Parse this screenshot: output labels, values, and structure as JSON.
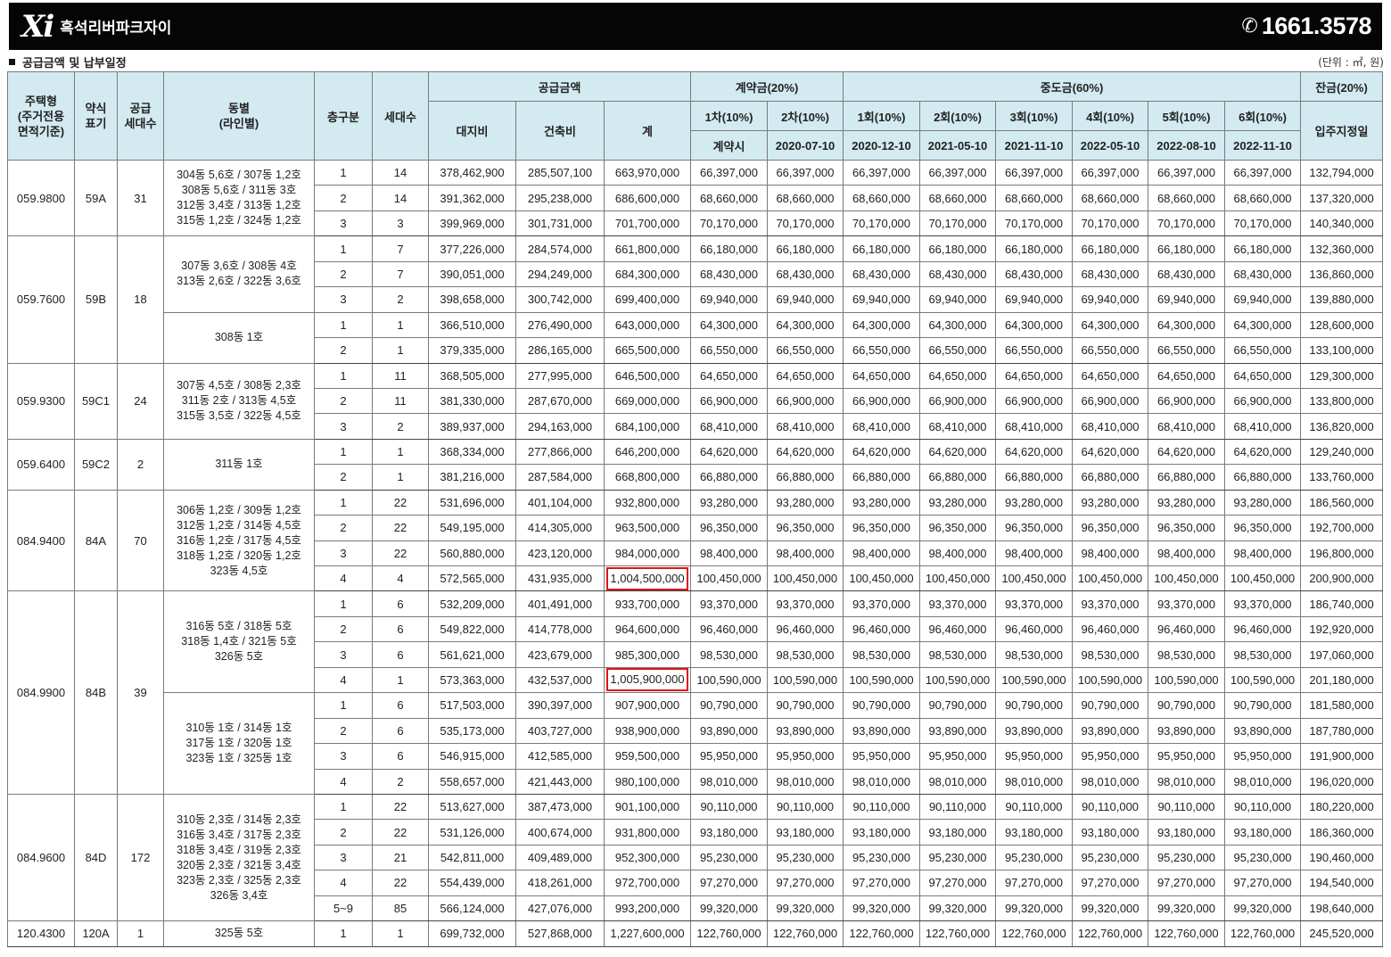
{
  "header": {
    "logo": "Xi",
    "brand_name": "흑석리버파크자이",
    "phone_icon": "phone-icon",
    "phone": "1661.3578",
    "background_color": "#050505"
  },
  "section": {
    "title": "공급금액 및 납부일정",
    "unit": "(단위 : ㎡, 원)"
  },
  "table": {
    "header_color": "#d3eaf0",
    "highlight_color": "#e01515",
    "headers": {
      "housing_type": [
        "주택형",
        "(주거전용",
        "면적기준)"
      ],
      "abbr": [
        "약식",
        "표기"
      ],
      "supply_units": [
        "공급",
        "세대수"
      ],
      "dong": [
        "동별",
        "(라인별)"
      ],
      "floor": "층구분",
      "units": "세대수",
      "supply_price": "공급금액",
      "land": "대지비",
      "building": "건축비",
      "total": "계",
      "contract": "계약금(20%)",
      "contract_1": "1차(10%)",
      "contract_2": "2차(10%)",
      "contract_1_date": "계약시",
      "contract_2_date": "2020-07-10",
      "middle": "중도금(60%)",
      "middle_labels": [
        "1회(10%)",
        "2회(10%)",
        "3회(10%)",
        "4회(10%)",
        "5회(10%)",
        "6회(10%)"
      ],
      "middle_dates": [
        "2020-12-10",
        "2021-05-10",
        "2021-11-10",
        "2022-05-10",
        "2022-08-10",
        "2022-11-10"
      ],
      "balance": "잔금(20%)",
      "balance_date": "입주지정일"
    },
    "types": [
      {
        "area": "059.9800",
        "abbr": "59A",
        "supply": "31",
        "groups": [
          {
            "dong": [
              "304동 5,6호 / 307동 1,2호",
              "308동 5,6호 / 311동 3호",
              "312동 3,4호 / 313동 1,2호",
              "315동 1,2호 / 324동 1,2호"
            ],
            "rows": [
              {
                "floor": "1",
                "units": "14",
                "land": "378,462,900",
                "building": "285,507,100",
                "total": "663,970,000",
                "contract": "66,397,000",
                "balance": "132,794,000"
              },
              {
                "floor": "2",
                "units": "14",
                "land": "391,362,000",
                "building": "295,238,000",
                "total": "686,600,000",
                "contract": "68,660,000",
                "balance": "137,320,000"
              },
              {
                "floor": "3",
                "units": "3",
                "land": "399,969,000",
                "building": "301,731,000",
                "total": "701,700,000",
                "contract": "70,170,000",
                "balance": "140,340,000"
              }
            ]
          }
        ]
      },
      {
        "area": "059.7600",
        "abbr": "59B",
        "supply": "18",
        "groups": [
          {
            "dong": [
              "307동 3,6호 / 308동 4호",
              "313동 2,6호 / 322동 3,6호"
            ],
            "rows": [
              {
                "floor": "1",
                "units": "7",
                "land": "377,226,000",
                "building": "284,574,000",
                "total": "661,800,000",
                "contract": "66,180,000",
                "balance": "132,360,000"
              },
              {
                "floor": "2",
                "units": "7",
                "land": "390,051,000",
                "building": "294,249,000",
                "total": "684,300,000",
                "contract": "68,430,000",
                "balance": "136,860,000"
              },
              {
                "floor": "3",
                "units": "2",
                "land": "398,658,000",
                "building": "300,742,000",
                "total": "699,400,000",
                "contract": "69,940,000",
                "balance": "139,880,000"
              }
            ]
          },
          {
            "dong": [
              "308동 1호"
            ],
            "rows": [
              {
                "floor": "1",
                "units": "1",
                "land": "366,510,000",
                "building": "276,490,000",
                "total": "643,000,000",
                "contract": "64,300,000",
                "balance": "128,600,000"
              },
              {
                "floor": "2",
                "units": "1",
                "land": "379,335,000",
                "building": "286,165,000",
                "total": "665,500,000",
                "contract": "66,550,000",
                "balance": "133,100,000"
              }
            ]
          }
        ]
      },
      {
        "area": "059.9300",
        "abbr": "59C1",
        "supply": "24",
        "groups": [
          {
            "dong": [
              "307동 4,5호 / 308동 2,3호",
              "311동 2호 / 313동 4,5호",
              "315동 3,5호 / 322동 4,5호"
            ],
            "rows": [
              {
                "floor": "1",
                "units": "11",
                "land": "368,505,000",
                "building": "277,995,000",
                "total": "646,500,000",
                "contract": "64,650,000",
                "balance": "129,300,000"
              },
              {
                "floor": "2",
                "units": "11",
                "land": "381,330,000",
                "building": "287,670,000",
                "total": "669,000,000",
                "contract": "66,900,000",
                "balance": "133,800,000"
              },
              {
                "floor": "3",
                "units": "2",
                "land": "389,937,000",
                "building": "294,163,000",
                "total": "684,100,000",
                "contract": "68,410,000",
                "balance": "136,820,000"
              }
            ]
          }
        ]
      },
      {
        "area": "059.6400",
        "abbr": "59C2",
        "supply": "2",
        "groups": [
          {
            "dong": [
              "311동 1호"
            ],
            "rows": [
              {
                "floor": "1",
                "units": "1",
                "land": "368,334,000",
                "building": "277,866,000",
                "total": "646,200,000",
                "contract": "64,620,000",
                "balance": "129,240,000"
              },
              {
                "floor": "2",
                "units": "1",
                "land": "381,216,000",
                "building": "287,584,000",
                "total": "668,800,000",
                "contract": "66,880,000",
                "balance": "133,760,000"
              }
            ]
          }
        ]
      },
      {
        "area": "084.9400",
        "abbr": "84A",
        "supply": "70",
        "groups": [
          {
            "dong": [
              "306동 1,2호 / 309동 1,2호",
              "312동 1,2호 / 314동 4,5호",
              "316동 1,2호 / 317동 4,5호",
              "318동 1,2호 / 320동 1,2호",
              "323동 4,5호"
            ],
            "rows": [
              {
                "floor": "1",
                "units": "22",
                "land": "531,696,000",
                "building": "401,104,000",
                "total": "932,800,000",
                "contract": "93,280,000",
                "balance": "186,560,000"
              },
              {
                "floor": "2",
                "units": "22",
                "land": "549,195,000",
                "building": "414,305,000",
                "total": "963,500,000",
                "contract": "96,350,000",
                "balance": "192,700,000"
              },
              {
                "floor": "3",
                "units": "22",
                "land": "560,880,000",
                "building": "423,120,000",
                "total": "984,000,000",
                "contract": "98,400,000",
                "balance": "196,800,000"
              },
              {
                "floor": "4",
                "units": "4",
                "land": "572,565,000",
                "building": "431,935,000",
                "total": "1,004,500,000",
                "contract": "100,450,000",
                "balance": "200,900,000",
                "highlight": true
              }
            ]
          }
        ]
      },
      {
        "area": "084.9900",
        "abbr": "84B",
        "supply": "39",
        "groups": [
          {
            "dong": [
              "316동 5호 / 318동 5호",
              "318동 1,4호 / 321동 5호",
              "326동 5호"
            ],
            "rows": [
              {
                "floor": "1",
                "units": "6",
                "land": "532,209,000",
                "building": "401,491,000",
                "total": "933,700,000",
                "contract": "93,370,000",
                "balance": "186,740,000"
              },
              {
                "floor": "2",
                "units": "6",
                "land": "549,822,000",
                "building": "414,778,000",
                "total": "964,600,000",
                "contract": "96,460,000",
                "balance": "192,920,000"
              },
              {
                "floor": "3",
                "units": "6",
                "land": "561,621,000",
                "building": "423,679,000",
                "total": "985,300,000",
                "contract": "98,530,000",
                "balance": "197,060,000"
              },
              {
                "floor": "4",
                "units": "1",
                "land": "573,363,000",
                "building": "432,537,000",
                "total": "1,005,900,000",
                "contract": "100,590,000",
                "balance": "201,180,000",
                "highlight": true
              }
            ]
          },
          {
            "dong": [
              "310동 1호 / 314동 1호",
              "317동 1호 / 320동 1호",
              "323동 1호 / 325동 1호"
            ],
            "rows": [
              {
                "floor": "1",
                "units": "6",
                "land": "517,503,000",
                "building": "390,397,000",
                "total": "907,900,000",
                "contract": "90,790,000",
                "balance": "181,580,000"
              },
              {
                "floor": "2",
                "units": "6",
                "land": "535,173,000",
                "building": "403,727,000",
                "total": "938,900,000",
                "contract": "93,890,000",
                "balance": "187,780,000"
              },
              {
                "floor": "3",
                "units": "6",
                "land": "546,915,000",
                "building": "412,585,000",
                "total": "959,500,000",
                "contract": "95,950,000",
                "balance": "191,900,000"
              },
              {
                "floor": "4",
                "units": "2",
                "land": "558,657,000",
                "building": "421,443,000",
                "total": "980,100,000",
                "contract": "98,010,000",
                "balance": "196,020,000"
              }
            ]
          }
        ]
      },
      {
        "area": "084.9600",
        "abbr": "84D",
        "supply": "172",
        "groups": [
          {
            "dong": [
              "310동 2,3호 / 314동 2,3호",
              "316동 3,4호 / 317동 2,3호",
              "318동 3,4호 / 319동 2,3호",
              "320동 2,3호 / 321동 3,4호",
              "323동 2,3호 / 325동 2,3호",
              "326동 3,4호"
            ],
            "rows": [
              {
                "floor": "1",
                "units": "22",
                "land": "513,627,000",
                "building": "387,473,000",
                "total": "901,100,000",
                "contract": "90,110,000",
                "balance": "180,220,000"
              },
              {
                "floor": "2",
                "units": "22",
                "land": "531,126,000",
                "building": "400,674,000",
                "total": "931,800,000",
                "contract": "93,180,000",
                "balance": "186,360,000"
              },
              {
                "floor": "3",
                "units": "21",
                "land": "542,811,000",
                "building": "409,489,000",
                "total": "952,300,000",
                "contract": "95,230,000",
                "balance": "190,460,000"
              },
              {
                "floor": "4",
                "units": "22",
                "land": "554,439,000",
                "building": "418,261,000",
                "total": "972,700,000",
                "contract": "97,270,000",
                "balance": "194,540,000"
              },
              {
                "floor": "5~9",
                "units": "85",
                "land": "566,124,000",
                "building": "427,076,000",
                "total": "993,200,000",
                "contract": "99,320,000",
                "balance": "198,640,000"
              }
            ]
          }
        ]
      },
      {
        "area": "120.4300",
        "abbr": "120A",
        "supply": "1",
        "groups": [
          {
            "dong": [
              "325동 5호"
            ],
            "rows": [
              {
                "floor": "1",
                "units": "1",
                "land": "699,732,000",
                "building": "527,868,000",
                "total": "1,227,600,000",
                "contract": "122,760,000",
                "balance": "245,520,000"
              }
            ]
          }
        ]
      }
    ]
  }
}
